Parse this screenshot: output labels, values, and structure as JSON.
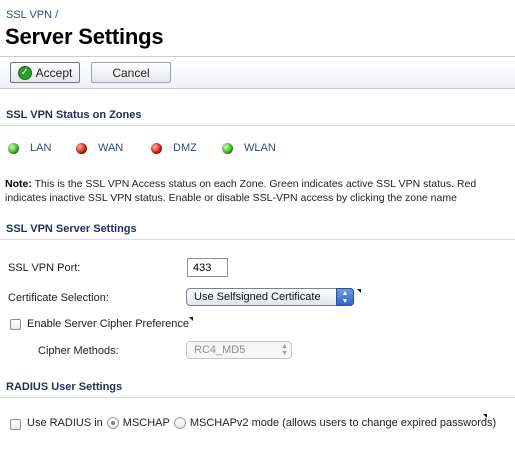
{
  "breadcrumb": "SSL VPN /",
  "title": "Server Settings",
  "toolbar": {
    "accept_label": "Accept",
    "cancel_label": "Cancel"
  },
  "status_section": {
    "heading": "SSL VPN Status on Zones",
    "zones": [
      {
        "label": "LAN",
        "status": "active",
        "color": "#3fc22f"
      },
      {
        "label": "WAN",
        "status": "inactive",
        "color": "#d8261a"
      },
      {
        "label": "DMZ",
        "status": "inactive",
        "color": "#d8261a"
      },
      {
        "label": "WLAN",
        "status": "active",
        "color": "#3fc22f"
      }
    ],
    "note_label": "Note:",
    "note_text": " This is the SSL VPN Access status on each Zone. Green indicates active SSL VPN status. Red indicates inactive SSL VPN status. Enable or disable SSL-VPN access by clicking the zone name"
  },
  "server_section": {
    "heading": "SSL VPN Server Settings",
    "port_label": "SSL VPN Port:",
    "port_value": "433",
    "certificate_label": "Certificate Selection:",
    "certificate_value": "Use Selfsigned Certificate",
    "cipher_pref_label": "Enable Server Cipher Preference",
    "cipher_pref_checked": false,
    "cipher_methods_label": "Cipher Methods:",
    "cipher_methods_value": "RC4_MD5"
  },
  "radius_section": {
    "heading": "RADIUS User Settings",
    "use_radius_label": "Use RADIUS in",
    "use_radius_checked": false,
    "option_mschap": "MSCHAP",
    "option_mschapv2": "MSCHAPv2 mode (allows users to change expired passwords)",
    "selected_option": "MSCHAP"
  },
  "icons": {
    "accept": "checkmark-icon",
    "select": "chevron-updown-icon",
    "tooltip": "tooltip-corner-icon"
  }
}
